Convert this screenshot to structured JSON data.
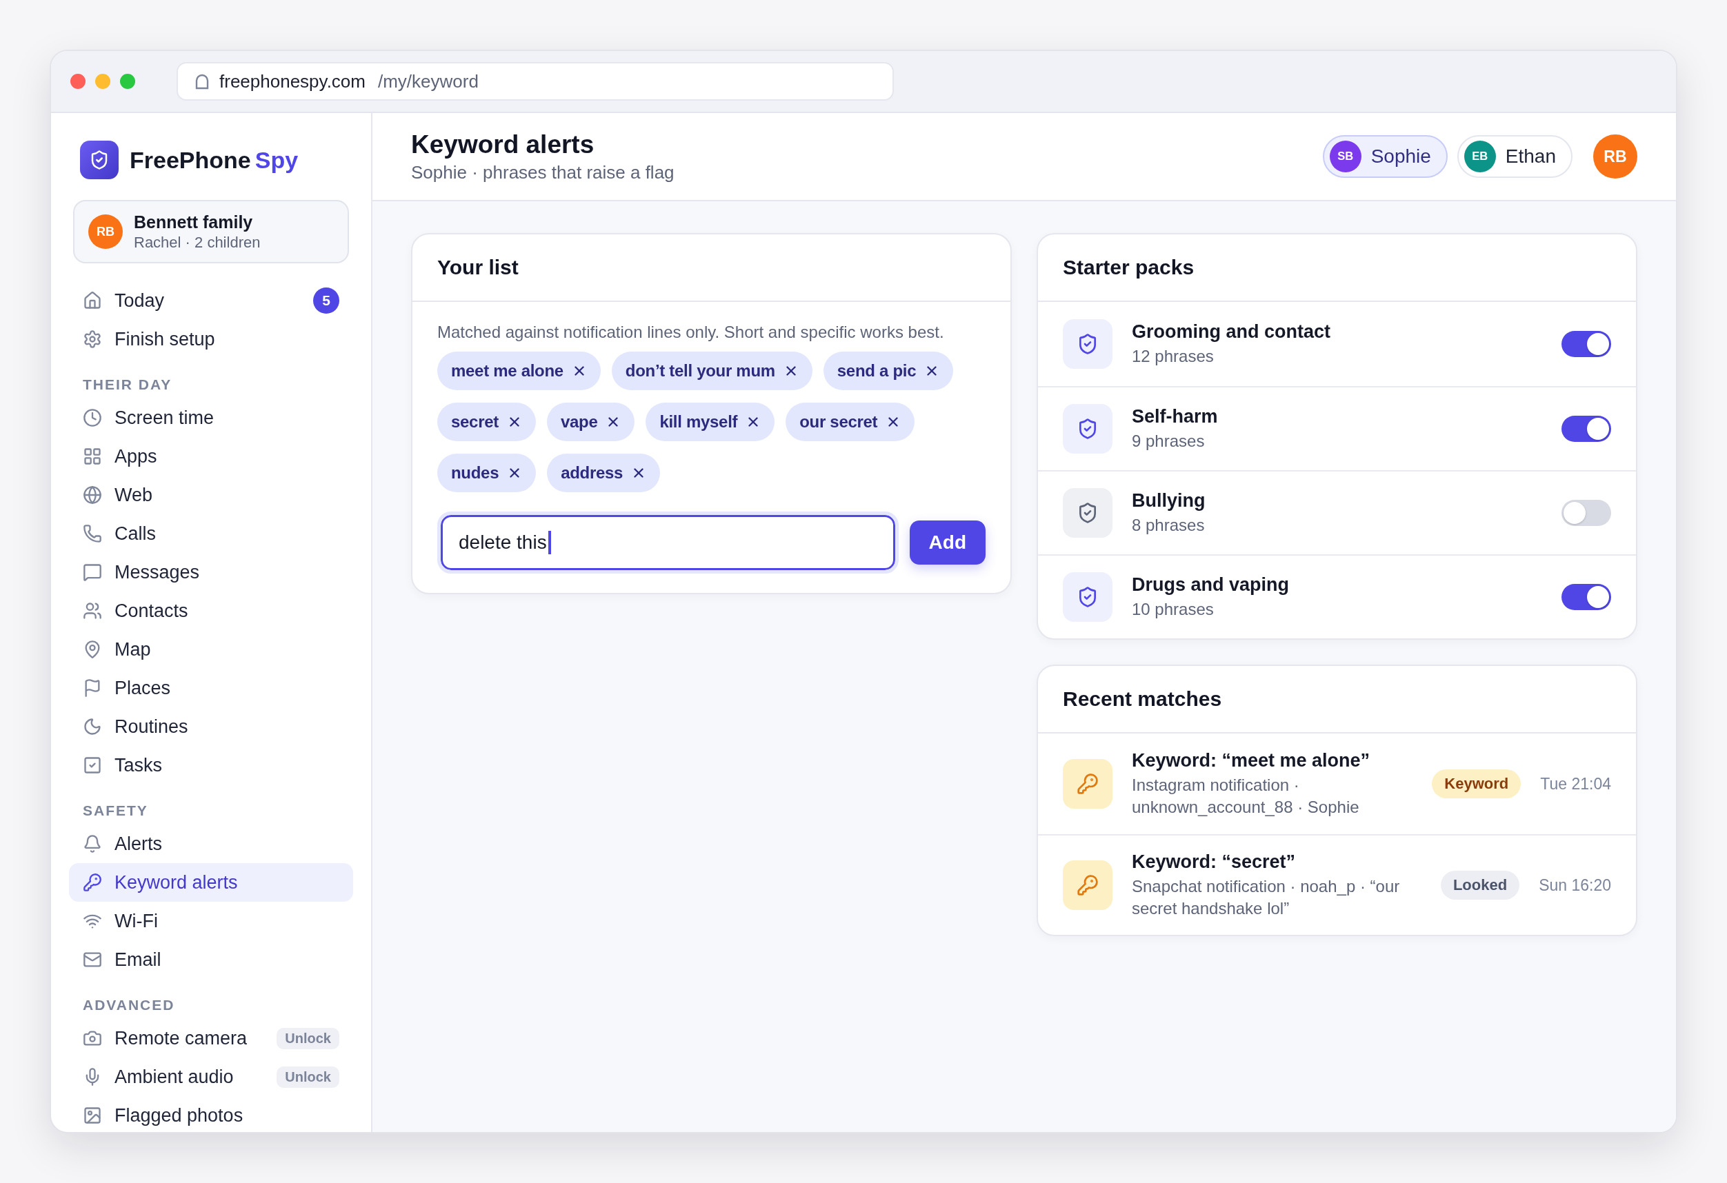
{
  "browser": {
    "domain": "freephonespy.com",
    "path": "/my/keyword"
  },
  "sidebar": {
    "brand": {
      "name": "FreePhone",
      "accent": "Spy"
    },
    "account": {
      "initials": "RB",
      "name": "Bennett family",
      "detail": "Rachel · 2 children"
    },
    "sections": [
      {
        "items": [
          {
            "label": "Today",
            "selected": false,
            "badge": "5"
          },
          {
            "label": "Finish setup",
            "selected": false
          }
        ]
      },
      {
        "heading": "THEIR DAY",
        "items": [
          {
            "label": "Screen time",
            "selected": false
          },
          {
            "label": "Apps",
            "selected": false
          },
          {
            "label": "Web",
            "selected": false
          },
          {
            "label": "Calls",
            "selected": false
          },
          {
            "label": "Messages",
            "selected": false
          },
          {
            "label": "Contacts",
            "selected": false
          },
          {
            "label": "Map",
            "selected": false
          },
          {
            "label": "Places",
            "selected": false
          },
          {
            "label": "Routines",
            "selected": false
          },
          {
            "label": "Tasks",
            "selected": false
          }
        ]
      },
      {
        "heading": "SAFETY",
        "items": [
          {
            "label": "Alerts",
            "selected": false
          },
          {
            "label": "Keyword alerts",
            "selected": true
          },
          {
            "label": "Wi-Fi",
            "selected": false
          },
          {
            "label": "Email",
            "selected": false
          }
        ]
      },
      {
        "heading": "ADVANCED",
        "items": [
          {
            "label": "Remote camera",
            "selected": false,
            "tag": "Unlock"
          },
          {
            "label": "Ambient audio",
            "selected": false,
            "tag": "Unlock"
          },
          {
            "label": "Flagged photos",
            "selected": false
          }
        ]
      }
    ]
  },
  "header": {
    "title": "Keyword alerts",
    "subtitle": "Sophie · phrases that raise a flag",
    "children": [
      {
        "initials": "SB",
        "name": "Sophie",
        "selected": true,
        "color": "#7c3aed"
      },
      {
        "initials": "EB",
        "name": "Ethan",
        "selected": false,
        "color": "#0d9488"
      }
    ],
    "user": {
      "initials": "RB"
    }
  },
  "your_list": {
    "title": "Your list",
    "hint": "Matched against notification lines only. Short and specific works best.",
    "keywords": [
      "meet me alone",
      "don’t tell your mum",
      "send a pic",
      "secret",
      "vape",
      "kill myself",
      "our secret",
      "nudes",
      "address"
    ],
    "input": {
      "value": "delete this"
    },
    "button": "Add"
  },
  "starter_packs": {
    "title": "Starter packs",
    "items": [
      {
        "name": "Grooming and contact",
        "count": "12 phrases",
        "on": true
      },
      {
        "name": "Self-harm",
        "count": "9 phrases",
        "on": true
      },
      {
        "name": "Bullying",
        "count": "8 phrases",
        "on": false
      },
      {
        "name": "Drugs and vaping",
        "count": "10 phrases",
        "on": true
      }
    ]
  },
  "recent_matches": {
    "title": "Recent matches",
    "items": [
      {
        "title": "Keyword: “meet me alone”",
        "detail": "Instagram notification · unknown_account_88 · Sophie",
        "tag": {
          "label": "Keyword",
          "kind": "keyword"
        },
        "time": "Tue 21:04"
      },
      {
        "title": "Keyword: “secret”",
        "detail": "Snapchat notification · noah_p · “our secret handshake lol”",
        "tag": {
          "label": "Looked",
          "kind": "looked"
        },
        "time": "Sun 16:20"
      }
    ]
  }
}
